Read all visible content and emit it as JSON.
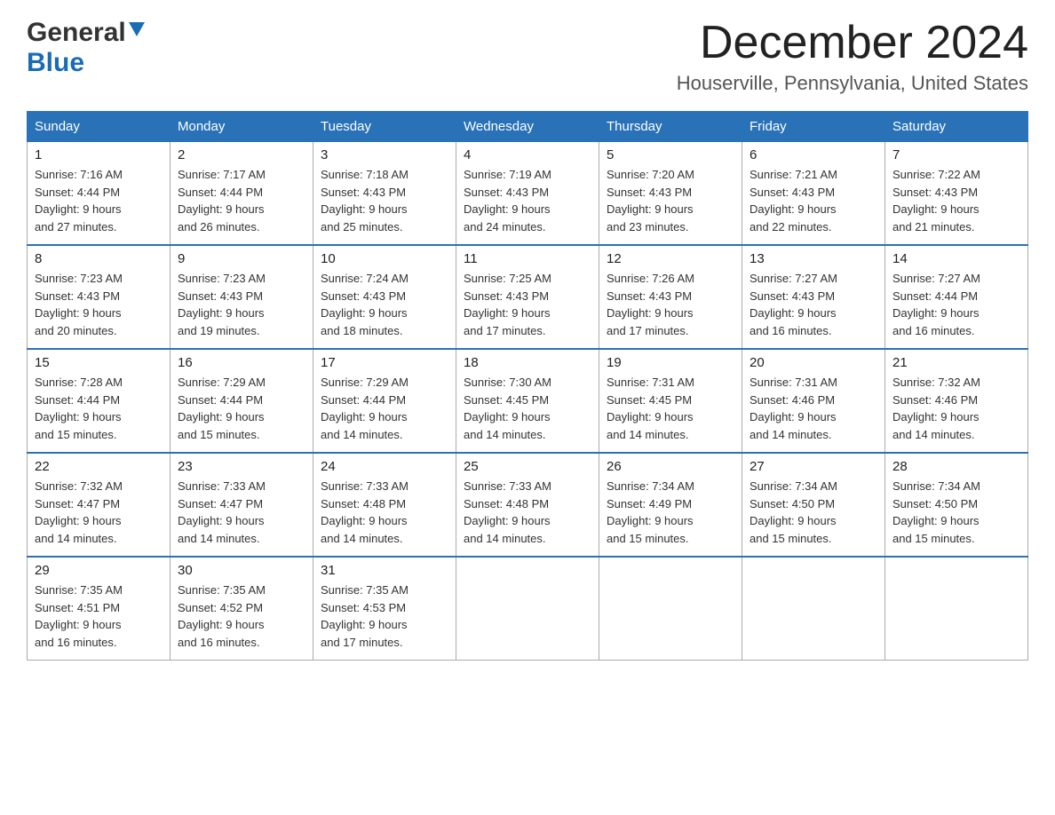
{
  "header": {
    "logo_general": "General",
    "logo_blue": "Blue",
    "month_year": "December 2024",
    "location": "Houserville, Pennsylvania, United States"
  },
  "days_of_week": [
    "Sunday",
    "Monday",
    "Tuesday",
    "Wednesday",
    "Thursday",
    "Friday",
    "Saturday"
  ],
  "weeks": [
    [
      {
        "day": "1",
        "sunrise": "7:16 AM",
        "sunset": "4:44 PM",
        "daylight": "9 hours and 27 minutes."
      },
      {
        "day": "2",
        "sunrise": "7:17 AM",
        "sunset": "4:44 PM",
        "daylight": "9 hours and 26 minutes."
      },
      {
        "day": "3",
        "sunrise": "7:18 AM",
        "sunset": "4:43 PM",
        "daylight": "9 hours and 25 minutes."
      },
      {
        "day": "4",
        "sunrise": "7:19 AM",
        "sunset": "4:43 PM",
        "daylight": "9 hours and 24 minutes."
      },
      {
        "day": "5",
        "sunrise": "7:20 AM",
        "sunset": "4:43 PM",
        "daylight": "9 hours and 23 minutes."
      },
      {
        "day": "6",
        "sunrise": "7:21 AM",
        "sunset": "4:43 PM",
        "daylight": "9 hours and 22 minutes."
      },
      {
        "day": "7",
        "sunrise": "7:22 AM",
        "sunset": "4:43 PM",
        "daylight": "9 hours and 21 minutes."
      }
    ],
    [
      {
        "day": "8",
        "sunrise": "7:23 AM",
        "sunset": "4:43 PM",
        "daylight": "9 hours and 20 minutes."
      },
      {
        "day": "9",
        "sunrise": "7:23 AM",
        "sunset": "4:43 PM",
        "daylight": "9 hours and 19 minutes."
      },
      {
        "day": "10",
        "sunrise": "7:24 AM",
        "sunset": "4:43 PM",
        "daylight": "9 hours and 18 minutes."
      },
      {
        "day": "11",
        "sunrise": "7:25 AM",
        "sunset": "4:43 PM",
        "daylight": "9 hours and 17 minutes."
      },
      {
        "day": "12",
        "sunrise": "7:26 AM",
        "sunset": "4:43 PM",
        "daylight": "9 hours and 17 minutes."
      },
      {
        "day": "13",
        "sunrise": "7:27 AM",
        "sunset": "4:43 PM",
        "daylight": "9 hours and 16 minutes."
      },
      {
        "day": "14",
        "sunrise": "7:27 AM",
        "sunset": "4:44 PM",
        "daylight": "9 hours and 16 minutes."
      }
    ],
    [
      {
        "day": "15",
        "sunrise": "7:28 AM",
        "sunset": "4:44 PM",
        "daylight": "9 hours and 15 minutes."
      },
      {
        "day": "16",
        "sunrise": "7:29 AM",
        "sunset": "4:44 PM",
        "daylight": "9 hours and 15 minutes."
      },
      {
        "day": "17",
        "sunrise": "7:29 AM",
        "sunset": "4:44 PM",
        "daylight": "9 hours and 14 minutes."
      },
      {
        "day": "18",
        "sunrise": "7:30 AM",
        "sunset": "4:45 PM",
        "daylight": "9 hours and 14 minutes."
      },
      {
        "day": "19",
        "sunrise": "7:31 AM",
        "sunset": "4:45 PM",
        "daylight": "9 hours and 14 minutes."
      },
      {
        "day": "20",
        "sunrise": "7:31 AM",
        "sunset": "4:46 PM",
        "daylight": "9 hours and 14 minutes."
      },
      {
        "day": "21",
        "sunrise": "7:32 AM",
        "sunset": "4:46 PM",
        "daylight": "9 hours and 14 minutes."
      }
    ],
    [
      {
        "day": "22",
        "sunrise": "7:32 AM",
        "sunset": "4:47 PM",
        "daylight": "9 hours and 14 minutes."
      },
      {
        "day": "23",
        "sunrise": "7:33 AM",
        "sunset": "4:47 PM",
        "daylight": "9 hours and 14 minutes."
      },
      {
        "day": "24",
        "sunrise": "7:33 AM",
        "sunset": "4:48 PM",
        "daylight": "9 hours and 14 minutes."
      },
      {
        "day": "25",
        "sunrise": "7:33 AM",
        "sunset": "4:48 PM",
        "daylight": "9 hours and 14 minutes."
      },
      {
        "day": "26",
        "sunrise": "7:34 AM",
        "sunset": "4:49 PM",
        "daylight": "9 hours and 15 minutes."
      },
      {
        "day": "27",
        "sunrise": "7:34 AM",
        "sunset": "4:50 PM",
        "daylight": "9 hours and 15 minutes."
      },
      {
        "day": "28",
        "sunrise": "7:34 AM",
        "sunset": "4:50 PM",
        "daylight": "9 hours and 15 minutes."
      }
    ],
    [
      {
        "day": "29",
        "sunrise": "7:35 AM",
        "sunset": "4:51 PM",
        "daylight": "9 hours and 16 minutes."
      },
      {
        "day": "30",
        "sunrise": "7:35 AM",
        "sunset": "4:52 PM",
        "daylight": "9 hours and 16 minutes."
      },
      {
        "day": "31",
        "sunrise": "7:35 AM",
        "sunset": "4:53 PM",
        "daylight": "9 hours and 17 minutes."
      },
      null,
      null,
      null,
      null
    ]
  ],
  "labels": {
    "sunrise": "Sunrise:",
    "sunset": "Sunset:",
    "daylight": "Daylight:"
  }
}
